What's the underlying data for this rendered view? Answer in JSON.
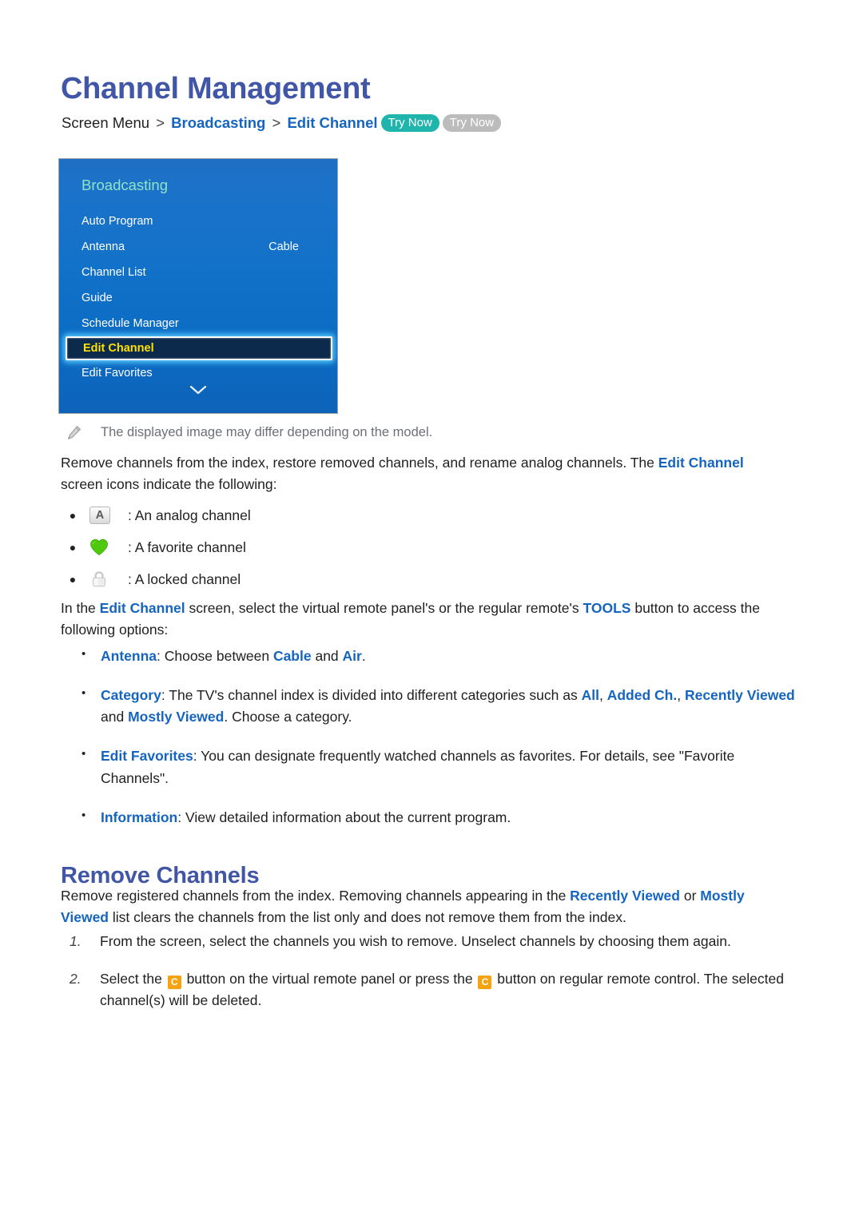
{
  "page_title": "Channel Management",
  "breadcrumb": {
    "root": "Screen Menu",
    "sep": ">",
    "level1": "Broadcasting",
    "level2": "Edit Channel",
    "try_now_primary": "Try Now",
    "try_now_secondary": "Try Now",
    "try_now_primary_color": "#1fb5ad",
    "try_now_secondary_color": "#bcbcbc"
  },
  "tv_menu": {
    "title": "Broadcasting",
    "accent_title_color": "#8fe3c6",
    "highlight_text_color": "#ffe000",
    "items": [
      {
        "label": "Auto Program",
        "value": "",
        "selected": false
      },
      {
        "label": "Antenna",
        "value": "Cable",
        "selected": false
      },
      {
        "label": "Channel List",
        "value": "",
        "selected": false
      },
      {
        "label": "Guide",
        "value": "",
        "selected": false
      },
      {
        "label": "Schedule Manager",
        "value": "",
        "selected": false
      },
      {
        "label": "Edit Channel",
        "value": "",
        "selected": true
      },
      {
        "label": "Edit Favorites",
        "value": "",
        "selected": false
      }
    ],
    "scroll_indicator": "chevron-down"
  },
  "note": {
    "icon": "pencil-icon",
    "text": "The displayed image may differ depending on the model."
  },
  "intro_paragraph": {
    "part1": "Remove channels from the index, restore removed channels, and rename analog channels. The ",
    "link1": "Edit Channel",
    "part2": " screen icons indicate the following:"
  },
  "icon_legend": [
    {
      "icon": "analog-letter-a-icon",
      "glyph": "A",
      "text": ": An analog channel"
    },
    {
      "icon": "green-heart-icon",
      "glyph": "",
      "text": ": A favorite channel"
    },
    {
      "icon": "padlock-icon",
      "glyph": "",
      "text": ": A locked channel"
    }
  ],
  "tools_paragraph": {
    "part1": "In the ",
    "link1": "Edit Channel",
    "part2": " screen, select the virtual remote panel's or the regular remote's ",
    "link2": "TOOLS",
    "part3": " button to access the following options:"
  },
  "options": [
    {
      "term": "Antenna",
      "segments": [
        {
          "text": ": Choose between ",
          "style": "plain"
        },
        {
          "text": "Cable",
          "style": "link"
        },
        {
          "text": " and ",
          "style": "plain"
        },
        {
          "text": "Air",
          "style": "link"
        },
        {
          "text": ".",
          "style": "plain"
        }
      ]
    },
    {
      "term": "Category",
      "segments": [
        {
          "text": ": The TV's channel index is divided into different categories such as ",
          "style": "plain"
        },
        {
          "text": "All",
          "style": "link"
        },
        {
          "text": ", ",
          "style": "plain"
        },
        {
          "text": "Added Ch.",
          "style": "link"
        },
        {
          "text": ", ",
          "style": "plain"
        },
        {
          "text": "Recently Viewed",
          "style": "link"
        },
        {
          "text": " and ",
          "style": "plain"
        },
        {
          "text": "Mostly Viewed",
          "style": "link"
        },
        {
          "text": ". Choose a category.",
          "style": "plain"
        }
      ]
    },
    {
      "term": "Edit Favorites",
      "segments": [
        {
          "text": ": You can designate frequently watched channels as favorites. For details, see \"Favorite Channels\".",
          "style": "plain"
        }
      ]
    },
    {
      "term": "Information",
      "segments": [
        {
          "text": ": View detailed information about the current program.",
          "style": "plain"
        }
      ]
    }
  ],
  "section_heading": "Remove Channels",
  "remove_paragraph": {
    "part1": "Remove registered channels from the index. Removing channels appearing in the ",
    "link1": "Recently Viewed",
    "part2": " or ",
    "link2": "Mostly Viewed",
    "part3": " list clears the channels from the list only and does not remove them from the index."
  },
  "steps": [
    {
      "num": "1.",
      "segments": [
        {
          "text": "From the screen, select the channels you wish to remove. Unselect channels by choosing them again.",
          "style": "plain"
        }
      ]
    },
    {
      "num": "2.",
      "segments": [
        {
          "text": "Select the ",
          "style": "plain"
        },
        {
          "text": "C",
          "style": "key"
        },
        {
          "text": " button on the virtual remote panel or press the ",
          "style": "plain"
        },
        {
          "text": "C",
          "style": "key"
        },
        {
          "text": " button on regular remote control. The selected channel(s) will be deleted.",
          "style": "plain"
        }
      ]
    }
  ],
  "colors": {
    "heading": "#4156a6",
    "link": "#1565c0",
    "key_button": "#f5a310",
    "note_text": "#6c6f78"
  }
}
